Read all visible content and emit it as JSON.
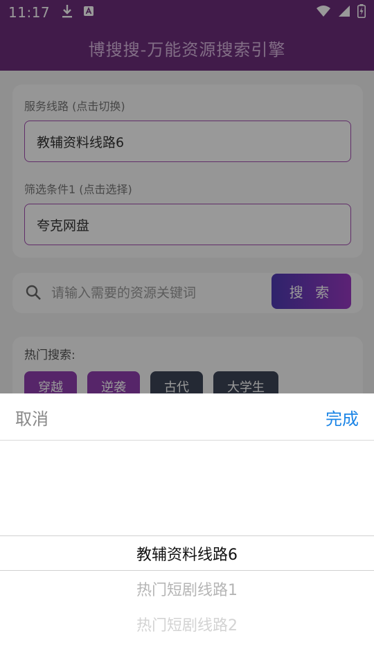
{
  "status_bar": {
    "time": "11:17",
    "icons": [
      "download-icon",
      "a-badge-icon",
      "wifi-icon",
      "signal-icon",
      "battery-charging-icon"
    ]
  },
  "app_bar": {
    "title": "博搜搜-万能资源搜索引擎"
  },
  "settings_card": {
    "route_label": "服务线路 (点击切换)",
    "route_value": "教辅资料线路6",
    "filter_label": "筛选条件1 (点击选择)",
    "filter_value": "夸克网盘"
  },
  "search": {
    "placeholder": "请输入需要的资源关键词",
    "button_label": "搜 索"
  },
  "hot": {
    "label": "热门搜索:",
    "tags": [
      "穿越",
      "逆袭",
      "古代",
      "大学生"
    ]
  },
  "picker": {
    "cancel_label": "取消",
    "done_label": "完成",
    "options": [
      "教辅资料线路6",
      "热门短剧线路1",
      "热门短剧线路2"
    ],
    "selected": "教辅资料线路6"
  }
}
